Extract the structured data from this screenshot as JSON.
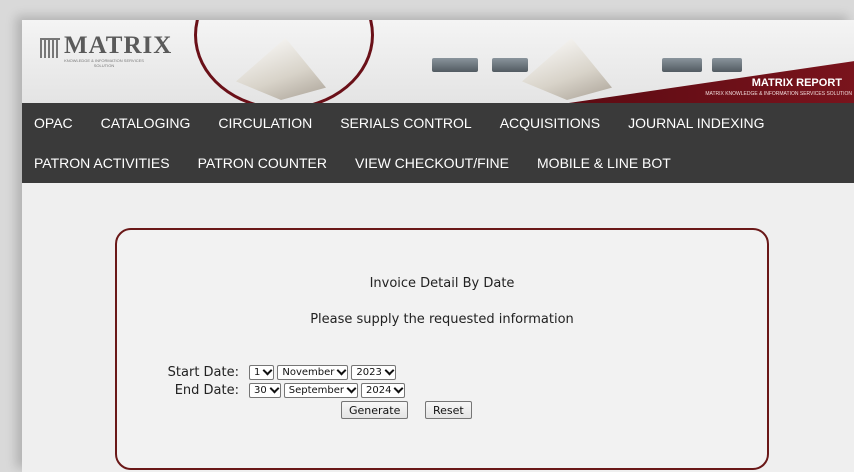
{
  "header": {
    "logo_title": "MATRIX",
    "logo_subtitle": "KNOWLEDGE & INFORMATION SERVICES SOLUTION",
    "report_title": "MATRIX REPORT",
    "report_subtitle": "MATRIX KNOWLEDGE & INFORMATION SERVICES SOLUTION"
  },
  "nav": {
    "row1": [
      "OPAC",
      "CATALOGING",
      "CIRCULATION",
      "SERIALS CONTROL",
      "ACQUISITIONS",
      "JOURNAL INDEXING"
    ],
    "row2": [
      "PATRON ACTIVITIES",
      "PATRON COUNTER",
      "VIEW CHECKOUT/FINE",
      "MOBILE & LINE BOT"
    ]
  },
  "form": {
    "title": "Invoice Detail By Date",
    "subtitle": "Please supply the requested information",
    "start_label": "Start Date:",
    "start_day": "1",
    "start_month": "November",
    "start_year": "2023",
    "end_label": "End Date:",
    "end_day": "30",
    "end_month": "September",
    "end_year": "2024",
    "generate_label": "Generate",
    "reset_label": "Reset"
  },
  "colors": {
    "accent": "#6a1018",
    "nav_bg": "#3a3a3a",
    "page_bg": "#efefef"
  }
}
